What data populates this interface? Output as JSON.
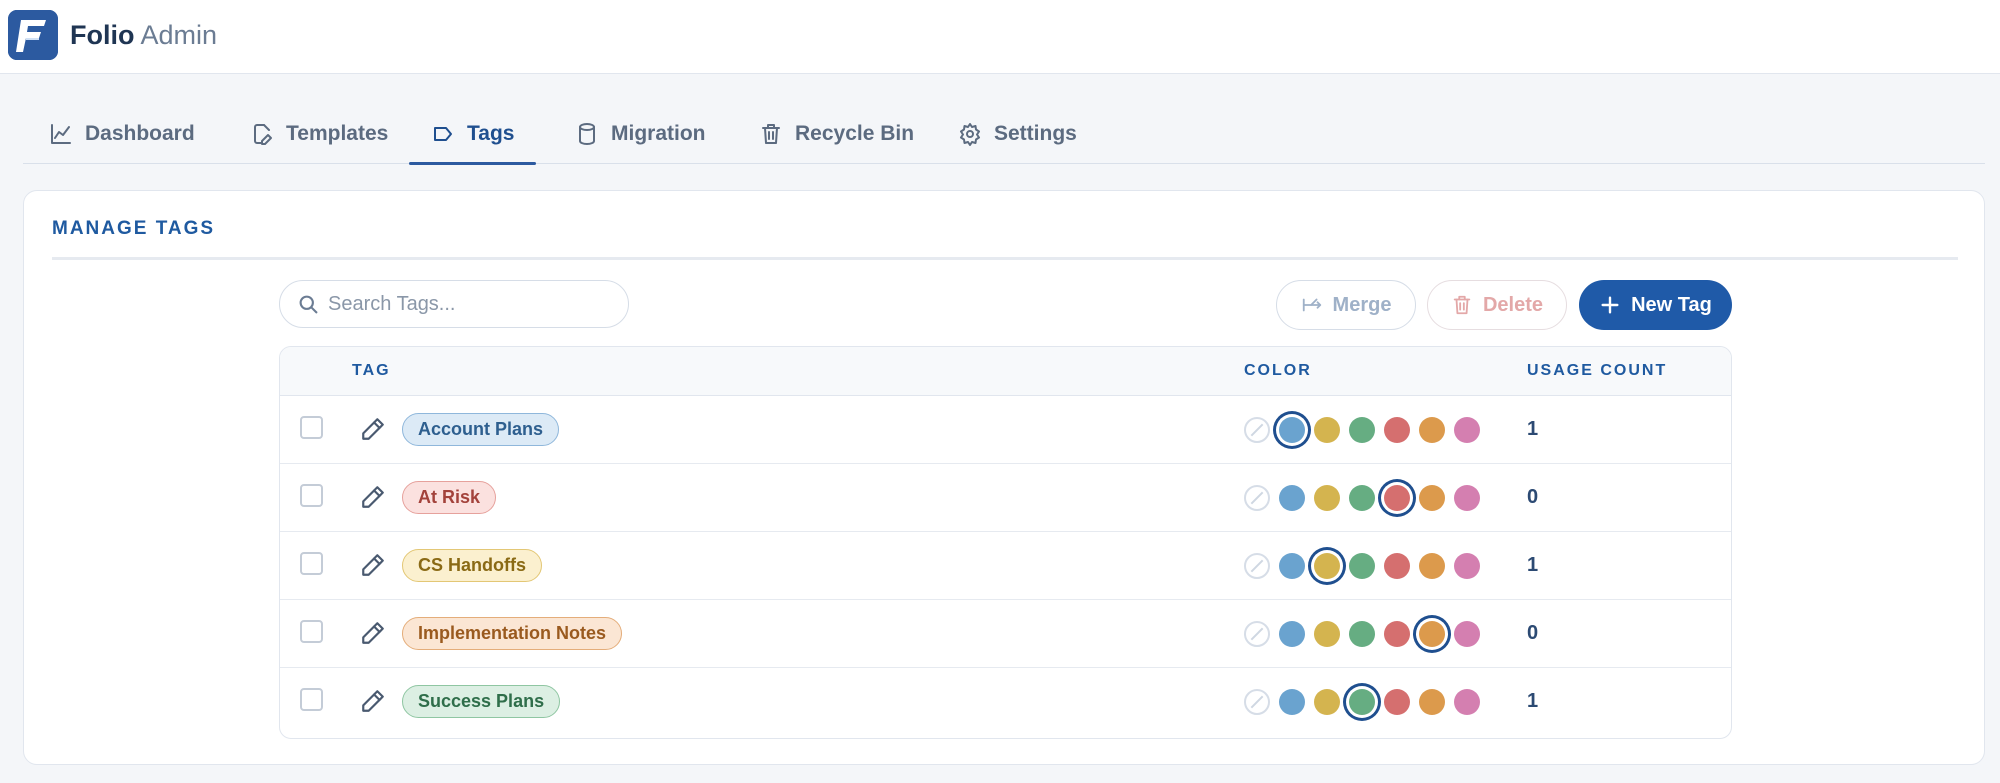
{
  "app": {
    "name_bold": "Folio",
    "name_light": "Admin",
    "logo_letter": "F"
  },
  "tabs": [
    {
      "label": "Dashboard",
      "icon": "chart-line-icon"
    },
    {
      "label": "Templates",
      "icon": "edit-document-icon"
    },
    {
      "label": "Tags",
      "icon": "tag-icon",
      "active": true
    },
    {
      "label": "Migration",
      "icon": "database-icon"
    },
    {
      "label": "Recycle Bin",
      "icon": "trash-icon"
    },
    {
      "label": "Settings",
      "icon": "gear-icon"
    }
  ],
  "manage": {
    "title": "MANAGE TAGS",
    "search_placeholder": "Search Tags...",
    "merge_label": "Merge",
    "delete_label": "Delete",
    "new_label": "New Tag"
  },
  "table": {
    "headers": {
      "tag": "TAG",
      "color": "COLOR",
      "usage": "USAGE COUNT"
    },
    "palette": [
      {
        "name": "none",
        "hex": ""
      },
      {
        "name": "blue",
        "hex": "#6aa3cf"
      },
      {
        "name": "yellow",
        "hex": "#d4b44f"
      },
      {
        "name": "green",
        "hex": "#66ad82"
      },
      {
        "name": "red",
        "hex": "#d56f6f"
      },
      {
        "name": "orange",
        "hex": "#dc9a4c"
      },
      {
        "name": "pink",
        "hex": "#d47fb0"
      }
    ],
    "rows": [
      {
        "name": "Account Plans",
        "color": "blue",
        "usage": "1",
        "pill_bg": "#dceaf6",
        "pill_border": "#8fb7db",
        "pill_text": "#2e5f8f"
      },
      {
        "name": "At Risk",
        "color": "red",
        "usage": "0",
        "pill_bg": "#fbe1df",
        "pill_border": "#e6a19c",
        "pill_text": "#a3423b"
      },
      {
        "name": "CS Handoffs",
        "color": "yellow",
        "usage": "1",
        "pill_bg": "#fbf0cf",
        "pill_border": "#e3c775",
        "pill_text": "#8a6a15"
      },
      {
        "name": "Implementation Notes",
        "color": "orange",
        "usage": "0",
        "pill_bg": "#fbe6d4",
        "pill_border": "#e4ad7a",
        "pill_text": "#9a5a1f"
      },
      {
        "name": "Success Plans",
        "color": "green",
        "usage": "1",
        "pill_bg": "#dcefe3",
        "pill_border": "#8fc6a2",
        "pill_text": "#2f6e4a"
      }
    ]
  }
}
